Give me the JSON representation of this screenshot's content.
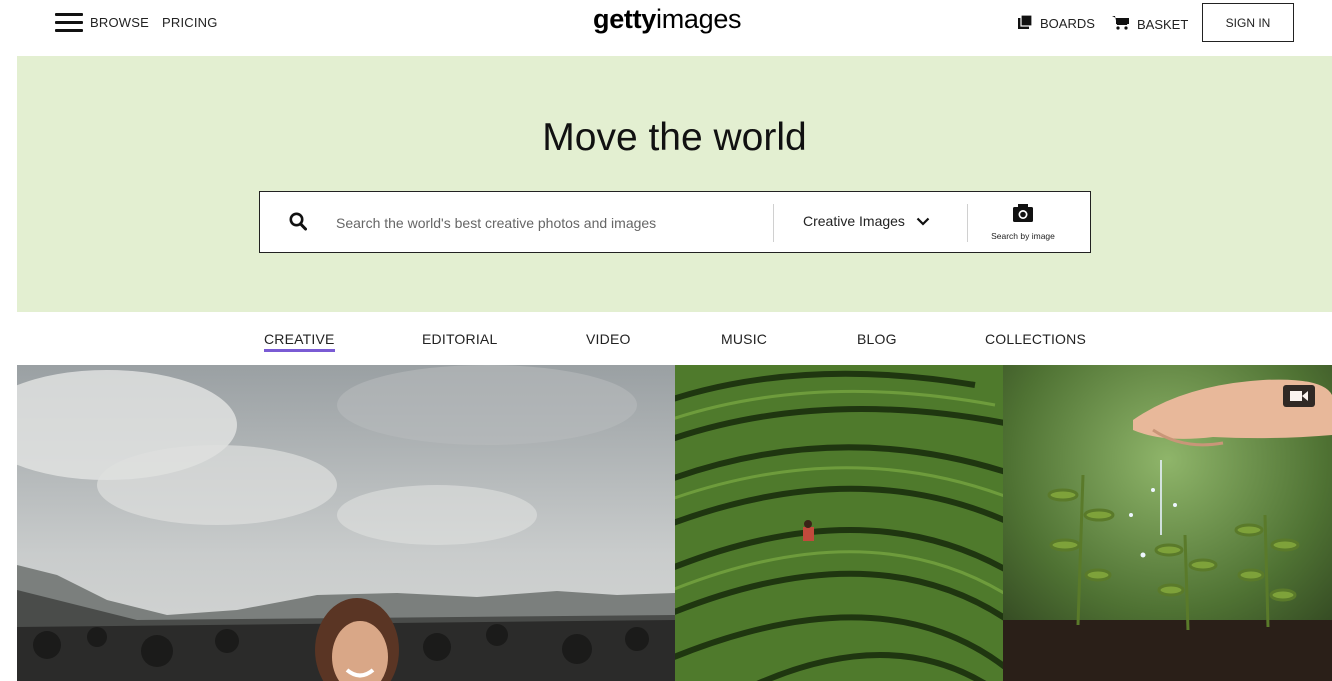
{
  "header": {
    "browse_label": "BROWSE",
    "pricing_label": "PRICING",
    "logo_bold": "getty",
    "logo_light": "images",
    "boards_label": "BOARDS",
    "basket_label": "BASKET",
    "signin_label": "SIGN IN"
  },
  "hero": {
    "title": "Move the world",
    "search_placeholder": "Search the world's best creative photos and images",
    "search_value": "",
    "select_value": "Creative Images",
    "search_by_image_label": "Search by image"
  },
  "tabs": [
    {
      "label": "CREATIVE",
      "active": true
    },
    {
      "label": "EDITORIAL",
      "active": false
    },
    {
      "label": "VIDEO",
      "active": false
    },
    {
      "label": "MUSIC",
      "active": false
    },
    {
      "label": "BLOG",
      "active": false
    },
    {
      "label": "COLLECTIONS",
      "active": false
    }
  ],
  "colors": {
    "hero_bg": "#e3efd1",
    "tab_active_underline": "#7a5bd4"
  },
  "icons": [
    "menu-icon",
    "boards-icon",
    "basket-icon",
    "search-icon",
    "chevron-down-icon",
    "camera-icon",
    "video-icon"
  ]
}
